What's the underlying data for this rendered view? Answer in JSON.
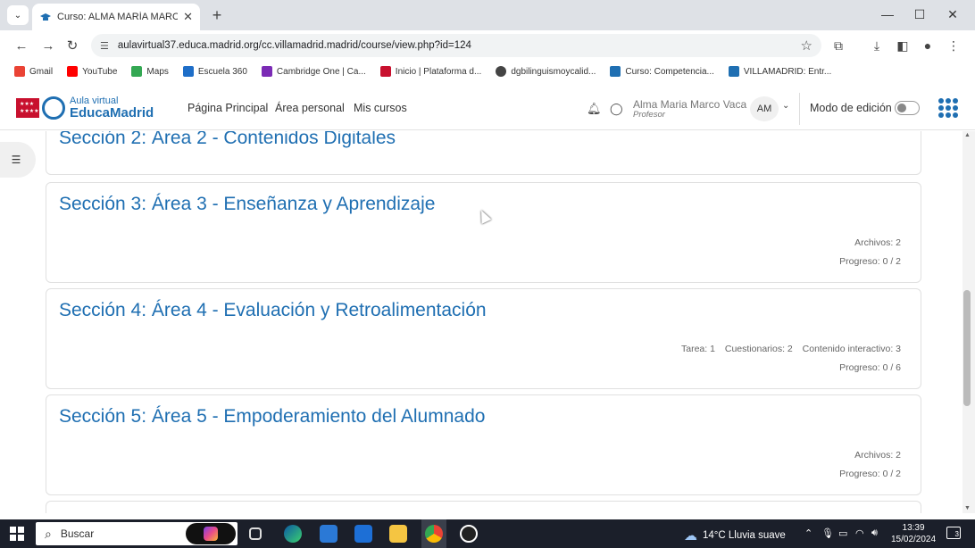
{
  "browser": {
    "tab_title": "Curso: ALMA MARÍA MARCO V",
    "url": "aulavirtual37.educa.madrid.org/cc.villamadrid.madrid/course/view.php?id=124",
    "bookmarks": [
      {
        "label": "Gmail",
        "color": "#ea4335"
      },
      {
        "label": "YouTube",
        "color": "#ff0000"
      },
      {
        "label": "Maps",
        "color": "#34a853"
      },
      {
        "label": "Escuela 360",
        "color": "#1e6ec8"
      },
      {
        "label": "Cambridge One | Ca...",
        "color": "#7b2bb5"
      },
      {
        "label": "Inicio | Plataforma d...",
        "color": "#c8102e"
      },
      {
        "label": "dgbilinguismoycalid...",
        "color": "#444444"
      },
      {
        "label": "Curso: Competencia...",
        "color": "#1f6fb2"
      },
      {
        "label": "VILLAMADRID: Entr...",
        "color": "#1f6fb2"
      }
    ]
  },
  "header": {
    "logo_small": "Aula virtual",
    "logo_big": "EducaMadrid",
    "nav": [
      "Página Principal",
      "Área personal",
      "Mis cursos"
    ],
    "user_name": "Alma Maria Marco Vaca",
    "user_role": "Profesor",
    "avatar_initials": "AM",
    "edit_mode_label": "Modo de edición",
    "edit_mode_on": false
  },
  "sections": [
    {
      "title": "Sección 2: Área 2 - Contenidos Digitales",
      "stats": [],
      "progress": ""
    },
    {
      "title": "Sección 3: Área 3 - Enseñanza y Aprendizaje",
      "stats": [
        "Archivos: 2"
      ],
      "progress": "Progreso: 0 / 2"
    },
    {
      "title": "Sección 4: Área 4 - Evaluación y Retroalimentación",
      "stats": [
        "Tarea: 1",
        "Cuestionarios: 2",
        "Contenido interactivo: 3"
      ],
      "progress": "Progreso: 0 / 6"
    },
    {
      "title": "Sección 5: Área 5 - Empoderamiento del Alumnado",
      "stats": [
        "Archivos: 2"
      ],
      "progress": "Progreso: 0 / 2"
    }
  ],
  "taskbar": {
    "search_placeholder": "Buscar",
    "weather": "14°C Lluvia suave",
    "time": "13:39",
    "date": "15/02/2024",
    "notifications": "3"
  },
  "colors": {
    "accent": "#1f6fb2",
    "brand_red": "#c8102e"
  }
}
